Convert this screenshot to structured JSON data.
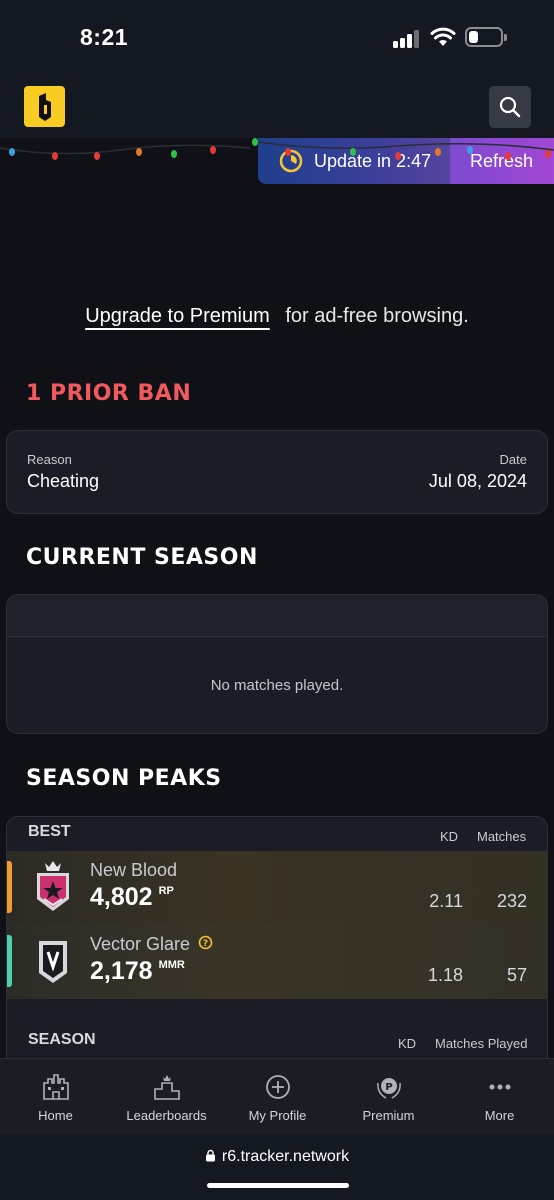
{
  "status": {
    "time": "8:21"
  },
  "header": {
    "logo_alt": "R6 Tracker",
    "search_icon": "search-icon"
  },
  "update_bar": {
    "update_text": "Update in 2:47",
    "refresh_label": "Refresh"
  },
  "promo": {
    "link": "Upgrade to Premium",
    "text": "for ad-free browsing."
  },
  "ban": {
    "title": "1 PRIOR BAN",
    "reason_label": "Reason",
    "reason_value": "Cheating",
    "date_label": "Date",
    "date_value": "Jul 08, 2024",
    "title_color": "#f05a5e"
  },
  "current_season": {
    "title": "CURRENT SEASON",
    "empty_text": "No matches played."
  },
  "season_peaks": {
    "title": "SEASON PEAKS",
    "best_label": "BEST",
    "kd_header": "KD",
    "matches_header": "Matches",
    "rows": [
      {
        "name": "New Blood",
        "value": "4,802",
        "unit": "RP",
        "kd": "2.11",
        "matches": "232",
        "accent": "#f39b2b",
        "icon": "champion-rank-icon"
      },
      {
        "name": "Vector Glare",
        "value": "2,178",
        "unit": "MMR",
        "kd": "1.18",
        "matches": "57",
        "accent": "#4fd1b0",
        "icon": "vector-glare-badge-icon"
      }
    ],
    "season_label": "SEASON",
    "season_kd_header": "KD",
    "season_matches_header": "Matches Played"
  },
  "nav": {
    "items": [
      {
        "label": "Home",
        "icon": "castle-icon"
      },
      {
        "label": "Leaderboards",
        "icon": "podium-icon"
      },
      {
        "label": "My Profile",
        "icon": "plus-circle-icon"
      },
      {
        "label": "Premium",
        "icon": "premium-icon"
      },
      {
        "label": "More",
        "icon": "more-icon"
      }
    ]
  },
  "browser": {
    "url": "r6.tracker.network"
  }
}
